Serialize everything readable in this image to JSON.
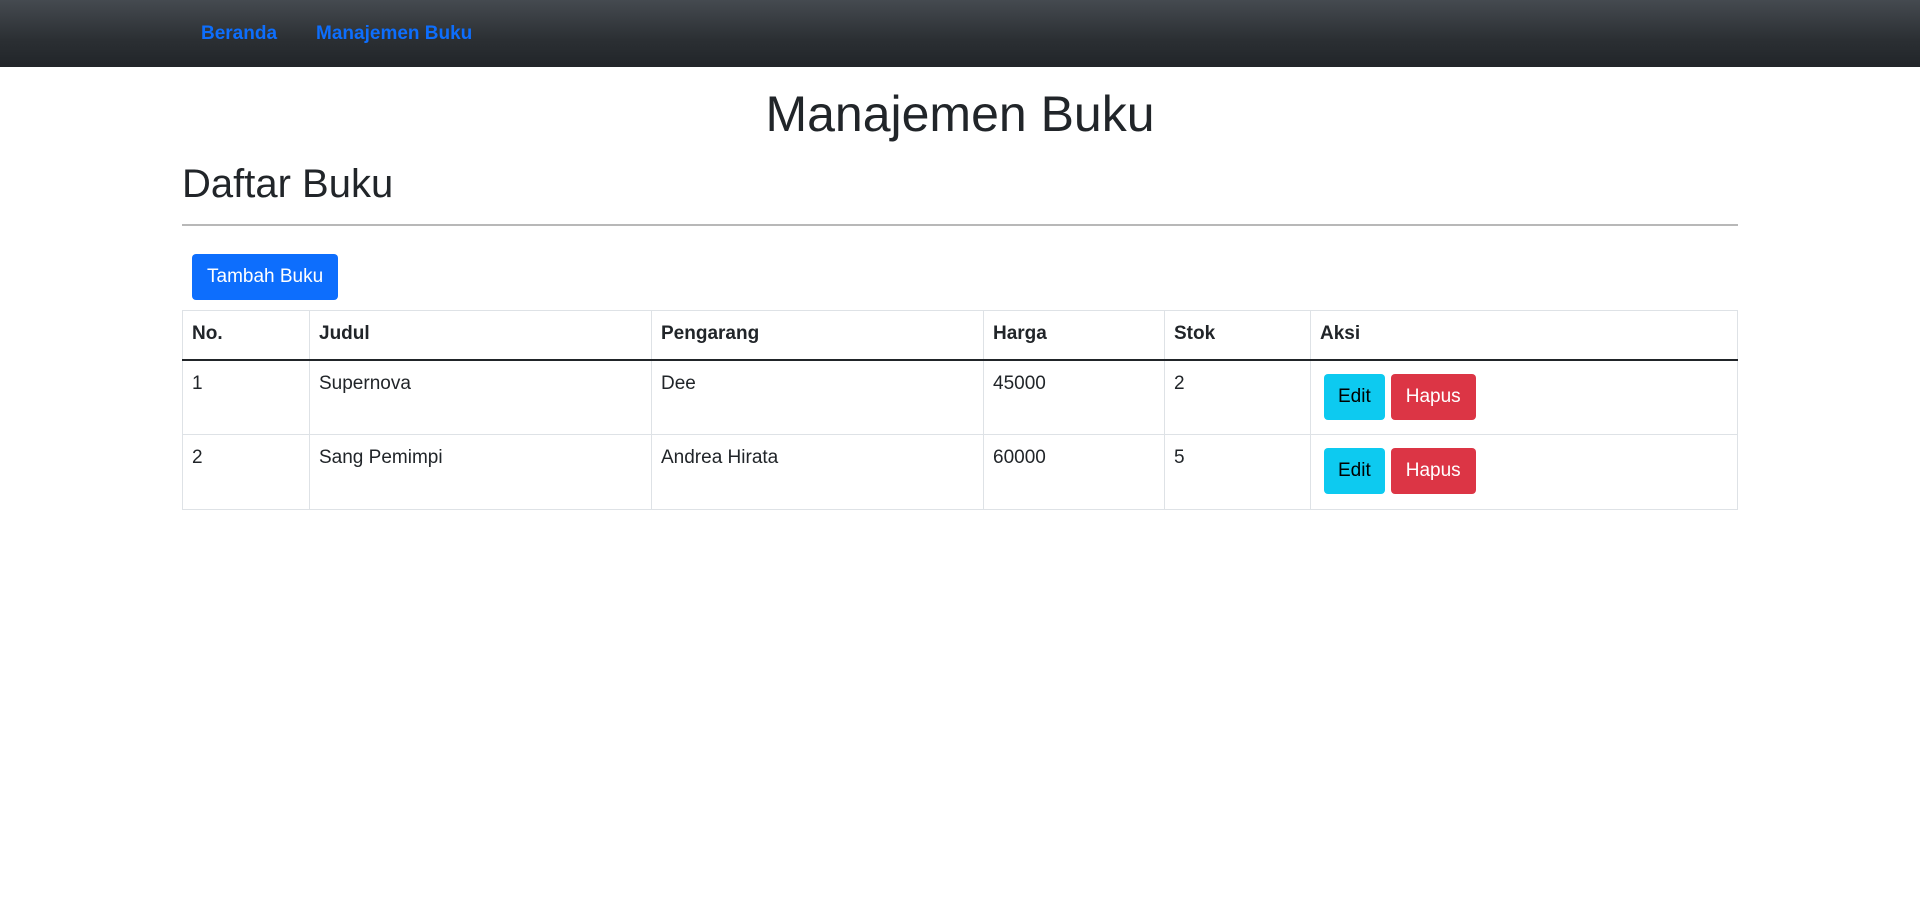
{
  "navbar": {
    "links": [
      {
        "label": "Beranda"
      },
      {
        "label": "Manajemen Buku"
      }
    ]
  },
  "page": {
    "title": "Manajemen Buku",
    "section_title": "Daftar Buku",
    "add_button_label": "Tambah Buku"
  },
  "table": {
    "headers": [
      "No.",
      "Judul",
      "Pengarang",
      "Harga",
      "Stok",
      "Aksi"
    ],
    "rows": [
      {
        "no": "1",
        "judul": "Supernova",
        "pengarang": "Dee",
        "harga": "45000",
        "stok": "2",
        "edit_label": "Edit",
        "delete_label": "Hapus"
      },
      {
        "no": "2",
        "judul": "Sang Pemimpi",
        "pengarang": "Andrea Hirata",
        "harga": "60000",
        "stok": "5",
        "edit_label": "Edit",
        "delete_label": "Hapus"
      }
    ]
  },
  "colors": {
    "navbar_bg": "#212529",
    "link": "#0d6efd",
    "primary": "#0d6efd",
    "info": "#0dcaf0",
    "danger": "#dc3545"
  }
}
